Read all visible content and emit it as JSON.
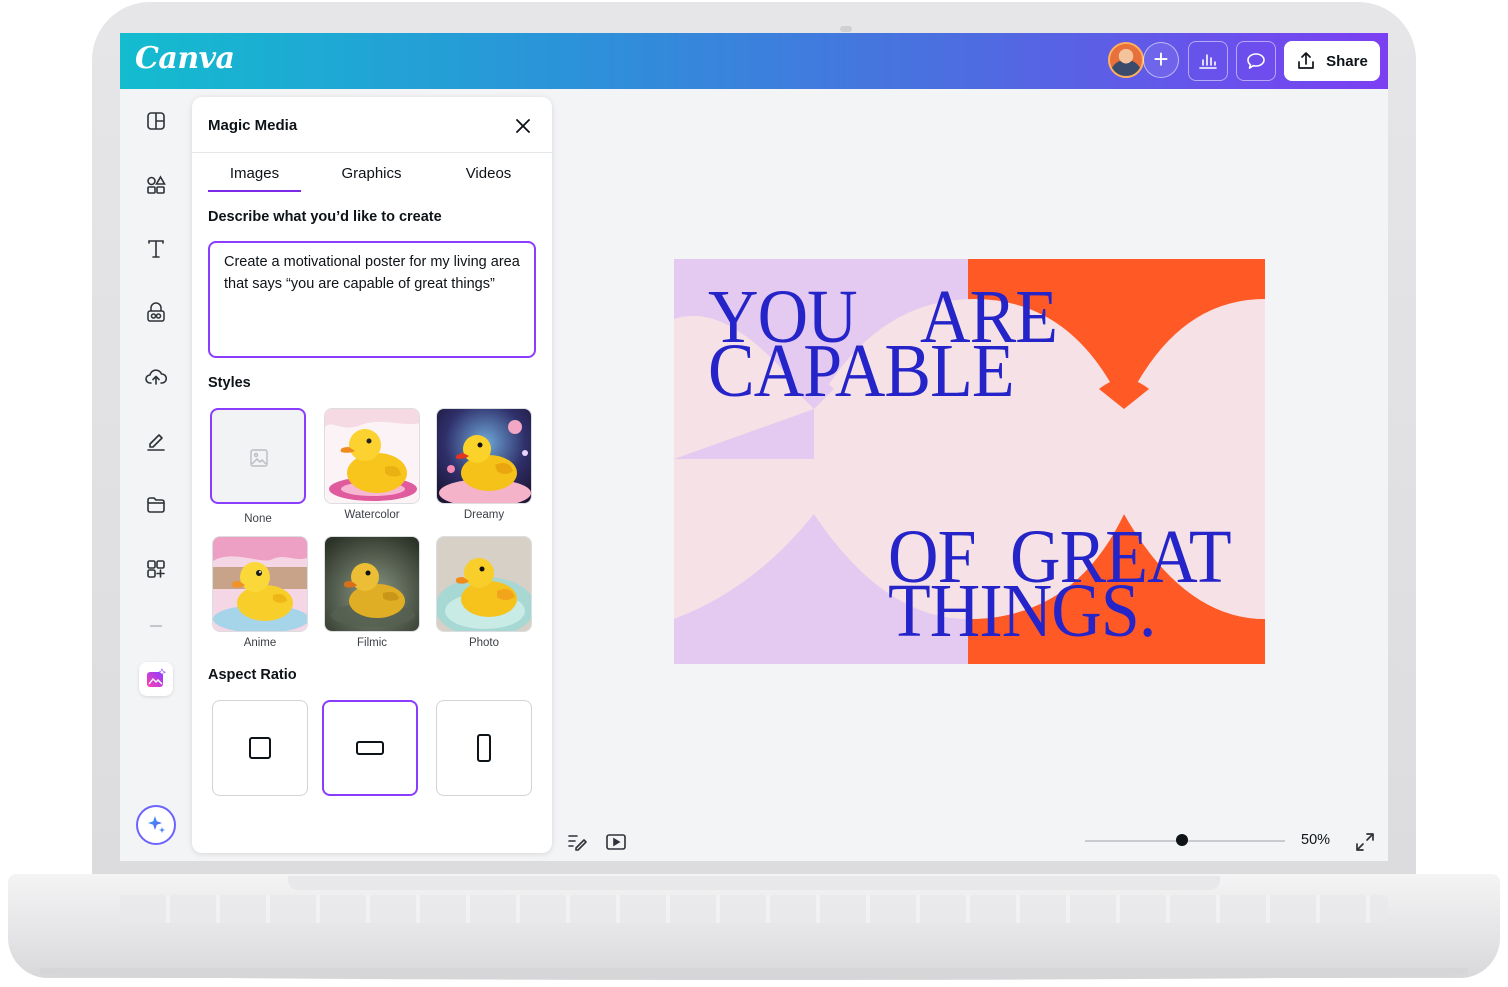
{
  "app": {
    "logo_text": "Canva",
    "share_label": "Share"
  },
  "panel": {
    "title": "Magic Media",
    "tabs": [
      {
        "label": "Images",
        "active": true
      },
      {
        "label": "Graphics"
      },
      {
        "label": "Videos"
      }
    ],
    "prompt_label": "Describe what you’d like to create",
    "prompt_value": "Create a motivational poster for my living area that says “you are capable of great things”",
    "styles_label": "Styles",
    "styles": [
      {
        "label": "None",
        "selected": true
      },
      {
        "label": "Watercolor"
      },
      {
        "label": "Dreamy"
      },
      {
        "label": "Anime"
      },
      {
        "label": "Filmic"
      },
      {
        "label": "Photo"
      }
    ],
    "aspect_label": "Aspect Ratio",
    "aspect_ratios": [
      {
        "name": "square"
      },
      {
        "name": "landscape",
        "selected": true
      },
      {
        "name": "portrait"
      }
    ]
  },
  "poster": {
    "line1a": "YOU",
    "line1b": "ARE",
    "line2": "CAPABLE",
    "line3a": "OF",
    "line3b": "GREAT",
    "line4": "THINGS.",
    "colors": {
      "bg": "#f6e1e6",
      "lilac": "#e4c9f0",
      "orange": "#ff5a26",
      "text": "#2524c9"
    }
  },
  "footer": {
    "zoom_label": "50%",
    "zoom_value": 50
  },
  "colors": {
    "accent": "#8b3dff",
    "topbar_start": "#13bccf",
    "topbar_end": "#7b3ff2"
  }
}
